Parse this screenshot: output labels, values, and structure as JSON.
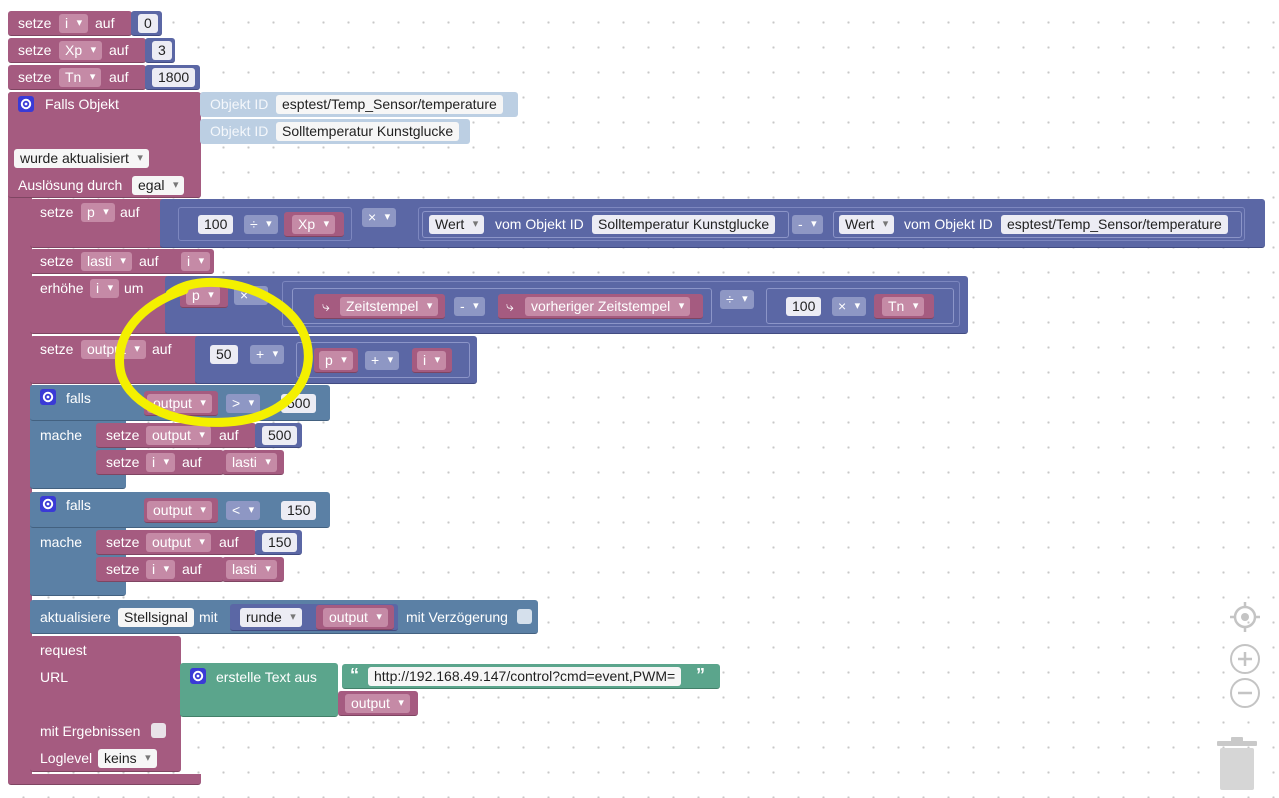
{
  "words": {
    "setze": "setze",
    "auf": "auf",
    "falls_objekt": "Falls Objekt",
    "objekt_id": "Objekt ID",
    "wurde_aktualisiert": "wurde aktualisiert",
    "ausloesung_durch": "Auslösung durch",
    "egal": "egal",
    "erhoehe": "erhöhe",
    "um": "um",
    "wert": "Wert",
    "vom_objekt_id": "vom Objekt ID",
    "falls": "falls",
    "mache": "mache",
    "aktualisiere": "aktualisiere",
    "mit": "mit",
    "mit_verzoegerung": "mit Verzögerung",
    "request": "request",
    "url": "URL",
    "erstelle_text_aus": "erstelle Text aus",
    "mit_ergebnissen": "mit Ergebnissen",
    "loglevel": "Loglevel",
    "keins": "keins",
    "runde": "runde",
    "zeitstempel": "Zeitstempel",
    "vorheriger_zeitstempel": "vorheriger Zeitstempel"
  },
  "vars": {
    "i": "i",
    "xp": "Xp",
    "tn": "Tn",
    "p": "p",
    "lasti": "lasti",
    "output": "output"
  },
  "ops": {
    "div": "÷",
    "mul": "×",
    "minus": "-",
    "plus": "+",
    "gt": ">",
    "lt": "<"
  },
  "nums": {
    "zero": "0",
    "three": "3",
    "n1800": "1800",
    "n100": "100",
    "n50": "50",
    "n500": "500",
    "n150": "150"
  },
  "object_ids": {
    "temp_sensor": "esptest/Temp_Sensor/temperature",
    "soll": "Solltemperatur Kunstglucke",
    "stellsignal": "Stellsignal"
  },
  "url_text": "http://192.168.49.147/control?cmd=event,PWM=",
  "quote_open": "“",
  "quote_close": "”",
  "colors": {
    "variables": "#a55b80",
    "math": "#5b67a5",
    "logic": "#5b80a5",
    "text": "#5ba58c",
    "object": "#bccfe3",
    "highlight": "#f4f000"
  },
  "icons": {
    "gear": "gear-icon",
    "return": "return-arrow-icon",
    "target": "center-target-icon",
    "zoom_in": "zoom-in-icon",
    "zoom_out": "zoom-out-icon",
    "trash": "trash-icon"
  }
}
